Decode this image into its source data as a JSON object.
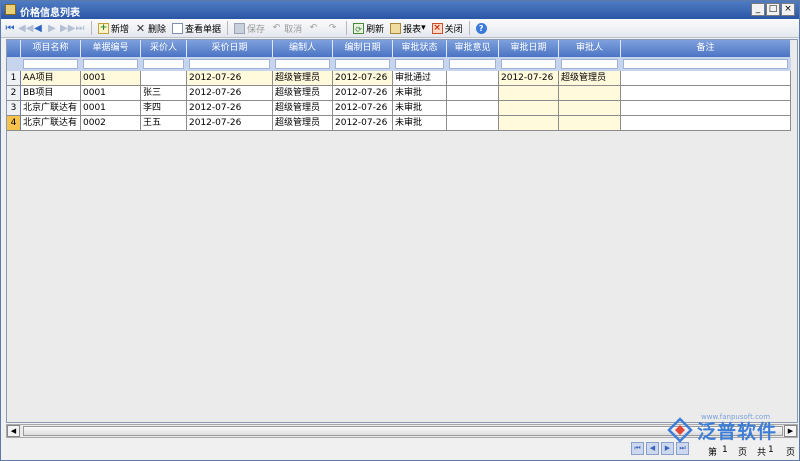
{
  "window": {
    "title": "价格信息列表",
    "minimize": "_",
    "restore": "□",
    "close": "×"
  },
  "toolbar": {
    "new": "新增",
    "delete": "删除",
    "view": "查看单据",
    "save": "保存",
    "cancel": "取消",
    "refresh": "刷新",
    "report": "报表",
    "report_arrow": "▾",
    "close": "关闭"
  },
  "grid": {
    "columns": [
      "项目名称",
      "单据编号",
      "采价人",
      "采价日期",
      "编制人",
      "编制日期",
      "审批状态",
      "审批意见",
      "审批日期",
      "审批人",
      "备注"
    ],
    "rows": [
      {
        "no": "1",
        "cells": [
          "AA项目",
          "0001",
          "",
          "2012-07-26",
          "超级管理员",
          "2012-07-26",
          "审批通过",
          "",
          "2012-07-26",
          "超级管理员",
          ""
        ]
      },
      {
        "no": "2",
        "cells": [
          "BB项目",
          "0001",
          "张三",
          "2012-07-26",
          "超级管理员",
          "2012-07-26",
          "未审批",
          "",
          "",
          "",
          ""
        ]
      },
      {
        "no": "3",
        "cells": [
          "北京广联达有",
          "0001",
          "李四",
          "2012-07-26",
          "超级管理员",
          "2012-07-26",
          "未审批",
          "",
          "",
          "",
          ""
        ]
      },
      {
        "no": "4",
        "cells": [
          "北京广联达有",
          "0002",
          "王五",
          "2012-07-26",
          "超级管理员",
          "2012-07-26",
          "未审批",
          "",
          "",
          "",
          ""
        ]
      }
    ]
  },
  "pager": {
    "page_label": "第",
    "page_value": "1",
    "page_unit": "页",
    "total_label": "共",
    "total_value": "1",
    "total_unit": "页"
  },
  "watermark": {
    "brand": "泛普软件",
    "url": "www.fanpusoft.com"
  },
  "colors": {
    "header_blue": "#5a82cc",
    "highlight_yellow": "#fffadc",
    "active_row": "#f6c24c",
    "brand_blue": "#3f7ed6"
  }
}
